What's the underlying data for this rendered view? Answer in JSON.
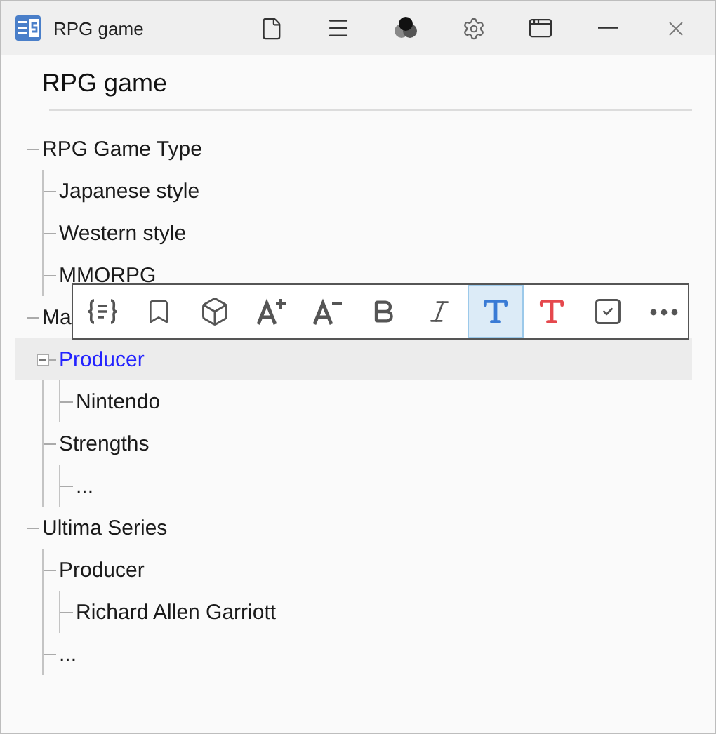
{
  "window": {
    "title": "RPG game"
  },
  "heading": "RPG game",
  "tree": [
    {
      "label": "RPG Game Type",
      "selected": false,
      "children": [
        {
          "label": "Japanese style",
          "selected": false
        },
        {
          "label": "Western style",
          "selected": false
        },
        {
          "label": "MMORPG",
          "selected": false
        }
      ]
    },
    {
      "label": "Ma",
      "selected": false,
      "children": [
        {
          "label": "Producer",
          "selected": true,
          "expanded": true,
          "children": [
            {
              "label": "Nintendo",
              "selected": false
            }
          ]
        },
        {
          "label": "Strengths",
          "selected": false,
          "children": [
            {
              "label": "...",
              "selected": false
            }
          ]
        }
      ]
    },
    {
      "label": "Ultima Series",
      "selected": false,
      "children": [
        {
          "label": "Producer",
          "selected": false,
          "children": [
            {
              "label": "Richard Allen Garriott",
              "selected": false
            }
          ]
        },
        {
          "label": "...",
          "selected": false
        }
      ]
    }
  ],
  "toolbar": [
    {
      "kind": "braces",
      "selected": false
    },
    {
      "kind": "bookmark",
      "selected": false
    },
    {
      "kind": "cube",
      "selected": false
    },
    {
      "kind": "grow",
      "selected": false
    },
    {
      "kind": "shrink",
      "selected": false
    },
    {
      "kind": "bold",
      "selected": false
    },
    {
      "kind": "italic",
      "selected": false
    },
    {
      "kind": "text",
      "selected": true,
      "color": "#3a7bd5"
    },
    {
      "kind": "text",
      "selected": false,
      "color": "#e5484d"
    },
    {
      "kind": "check",
      "selected": false
    },
    {
      "kind": "more",
      "selected": false
    }
  ]
}
